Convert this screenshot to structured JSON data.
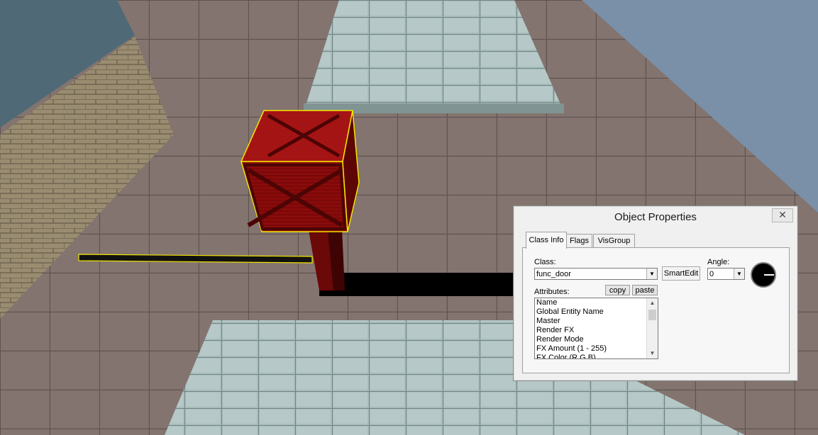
{
  "dialog": {
    "title": "Object Properties",
    "close_glyph": "✕",
    "tabs": [
      {
        "label": "Class Info",
        "active": true
      },
      {
        "label": "Flags",
        "active": false
      },
      {
        "label": "VisGroup",
        "active": false
      }
    ],
    "class_label": "Class:",
    "class_value": "func_door",
    "smartedit_label": "SmartEdit",
    "angle_label": "Angle:",
    "angle_value": "0",
    "attributes_label": "Attributes:",
    "copy_label": "copy",
    "paste_label": "paste",
    "attributes": [
      "Name",
      "Global Entity Name",
      "Master",
      "Render FX",
      "Render Mode",
      "FX Amount (1 - 255)",
      "FX Color (R G B)"
    ],
    "icons": {
      "close": "close-icon",
      "dropdown": "chevron-down-icon",
      "scroll_up": "scroll-up-arrow-icon",
      "scroll_down": "scroll-down-arrow-icon",
      "angle_dial": "angle-dial-icon"
    }
  },
  "scene": {
    "selection_color": "#f2e600",
    "crate_color": "#8a0b0b",
    "sky_color": "#7a90a8",
    "floor_color": "#7e6f6b",
    "tile_color": "#9fb6b6"
  }
}
